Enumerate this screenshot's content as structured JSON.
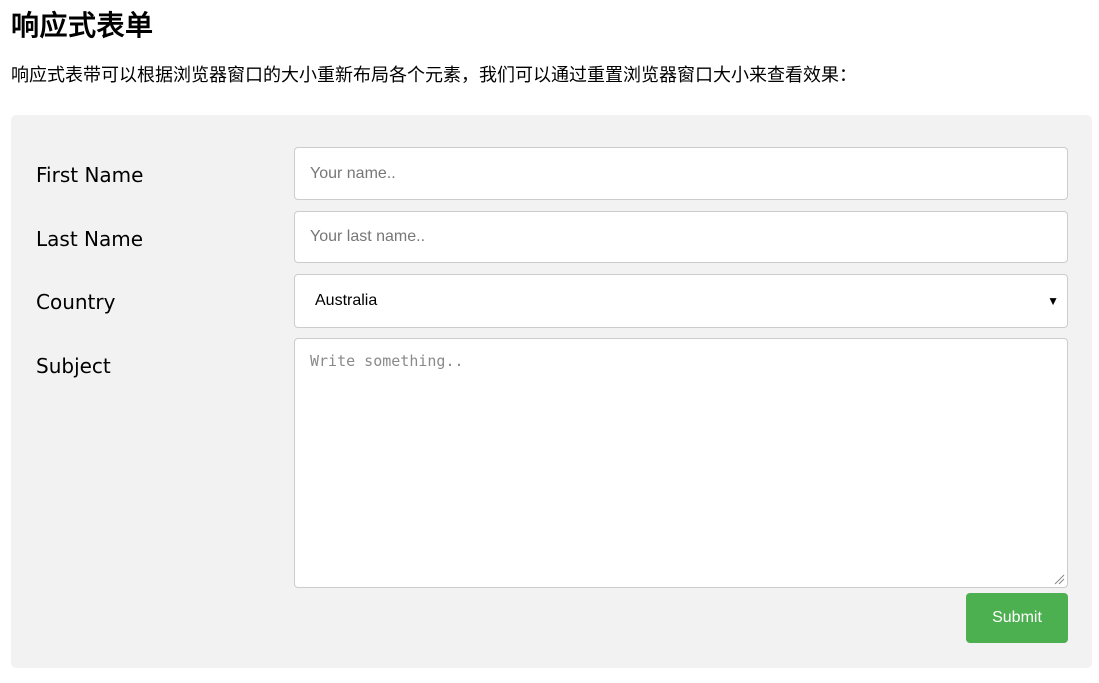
{
  "page": {
    "title": "响应式表单",
    "intro": "响应式表带可以根据浏览器窗口的大小重新布局各个元素，我们可以通过重置浏览器窗口大小来查看效果："
  },
  "form": {
    "first_name": {
      "label": "First Name",
      "placeholder": "Your name..",
      "value": ""
    },
    "last_name": {
      "label": "Last Name",
      "placeholder": "Your last name..",
      "value": ""
    },
    "country": {
      "label": "Country",
      "selected": "Australia",
      "arrow_icon": "triangle-down"
    },
    "subject": {
      "label": "Subject",
      "placeholder": "Write something..",
      "value": ""
    },
    "submit_label": "Submit"
  },
  "colors": {
    "panel_background": "#f2f2f2",
    "field_border": "#cccccc",
    "submit_background": "#4caf50",
    "submit_text": "#ffffff"
  }
}
